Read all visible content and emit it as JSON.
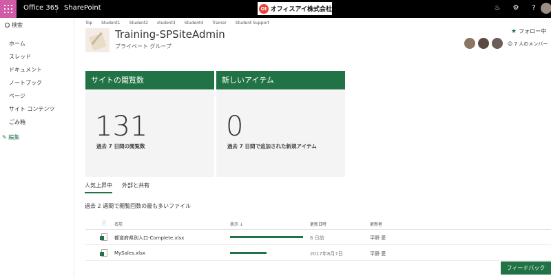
{
  "suite": {
    "brand": "Office 365",
    "app": "SharePoint",
    "logo_text": "オフィスアイ株式会社",
    "logo_mark": "OI"
  },
  "nav": {
    "search_label": "検索",
    "items": [
      "ホーム",
      "スレッド",
      "ドキュメント",
      "ノートブック",
      "ページ",
      "サイト コンテンツ",
      "ごみ箱"
    ],
    "edit_label": "編集"
  },
  "breadcrumb": [
    "Top",
    "Student1",
    "Student2",
    "student3",
    "Student4",
    "Trainer",
    "Student Support"
  ],
  "site": {
    "title": "Training-SPSiteAdmin",
    "subtitle": "プライベート グループ"
  },
  "follow_label": "フォロー中",
  "members_label": "7 人のメンバー",
  "tiles": [
    {
      "header": "サイトの閲覧数",
      "value": "131",
      "caption": "過去 7 日間の閲覧数"
    },
    {
      "header": "新しいアイテム",
      "value": "0",
      "caption": "過去 7 日間で追加された新規アイテム"
    }
  ],
  "tabs": [
    "人気上昇中",
    "外部と共有"
  ],
  "section_desc": "過去 2 週間で閲覧回数の最も多いファイル",
  "table": {
    "headers": {
      "name": "名前",
      "views": "表示 ↓",
      "modified": "更新日時",
      "modified_by": "更新者"
    },
    "rows": [
      {
        "name": "都道府県別人口-Complete.xlsx",
        "views_fraction": 1.0,
        "modified": "6 日前",
        "modified_by": "平野 愛"
      },
      {
        "name": "MySales.xlsx",
        "views_fraction": 0.5,
        "modified": "2017年8月7日",
        "modified_by": "平野 愛"
      }
    ]
  },
  "feedback_label": "フィードバック",
  "colors": {
    "accent": "#217346",
    "waffle": "#d05ca8",
    "suite_bar": "#000000"
  }
}
